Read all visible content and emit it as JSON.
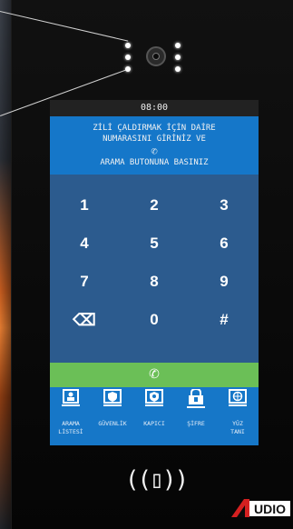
{
  "screen": {
    "time": "08:00",
    "instruction_line1": "ZİLİ ÇALDIRMAK İÇİN DAİRE",
    "instruction_line2": "NUMARASINI GİRİNİZ VE",
    "phone_glyph": "✆",
    "instruction_line3": "ARAMA BUTONUNA BASINIZ"
  },
  "keypad": {
    "keys": [
      "1",
      "2",
      "3",
      "4",
      "5",
      "6",
      "7",
      "8",
      "9",
      "⌫",
      "0",
      "#"
    ]
  },
  "call_button": {
    "icon": "phone-icon",
    "glyph": "✆"
  },
  "menu": {
    "items": [
      {
        "label": "ARAMA\nLİSTESİ",
        "icon": "contacts-icon"
      },
      {
        "label": "GÜVENLİK",
        "icon": "security-icon"
      },
      {
        "label": "KAPICI",
        "icon": "concierge-icon"
      },
      {
        "label": "ŞİFRE",
        "icon": "password-icon"
      },
      {
        "label": "YÜZ\nTANI",
        "icon": "face-recognition-icon"
      }
    ]
  },
  "nfc": {
    "glyph": "((▯))"
  },
  "brand": {
    "text": "AUDIO",
    "accent": "#d42020"
  },
  "colors": {
    "message_bg": "#1577c9",
    "keypad_bg": "#2c5b8e",
    "call_bg": "#6bbf57"
  }
}
